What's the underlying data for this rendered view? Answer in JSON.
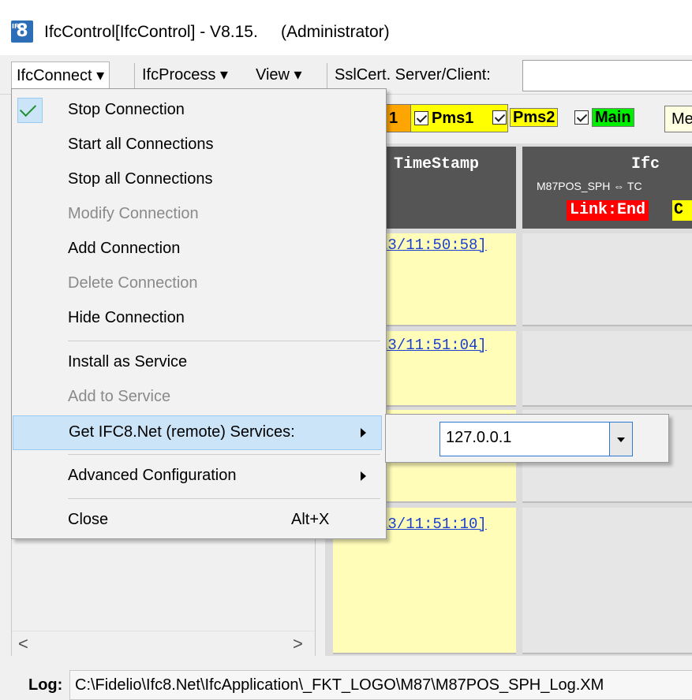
{
  "window": {
    "title": "IfcControl[IfcControl] - V8.15.     (Administrator)",
    "logo_text": "8",
    "logo_small": "IFC"
  },
  "menubar": {
    "items": [
      "IfcConnect ▾",
      "IfcProcess ▾",
      "View ▾",
      "SslCert. Server/Client:"
    ]
  },
  "toolbar": {
    "checks": [
      "1",
      "Pms1",
      "Pms2",
      "Main"
    ],
    "message_box": "Me"
  },
  "grid": {
    "header_timestamp": "TimeStamp",
    "header_ifc_title": "Ifc",
    "header_ifc_sub": "M87POS_SPH ⇔ TC",
    "link_end": "Link:End",
    "link_c": "C",
    "timestamps": [
      "13/11:50:58]",
      "13/11:51:04]",
      "13/11:51:10]"
    ]
  },
  "dropdown": {
    "items": [
      {
        "label": "Stop Connection",
        "checked": true,
        "enabled": true
      },
      {
        "label": "Start all Connections",
        "enabled": true
      },
      {
        "label": "Stop all Connections",
        "enabled": true
      },
      {
        "label": "Modify Connection",
        "enabled": false
      },
      {
        "label": "Add Connection",
        "enabled": true
      },
      {
        "label": "Delete Connection",
        "enabled": false
      },
      {
        "label": "Hide Connection",
        "enabled": true
      },
      {
        "label": "Install as Service",
        "enabled": true
      },
      {
        "label": "Add to Service",
        "enabled": false
      },
      {
        "label": "Get IFC8.Net (remote) Services:",
        "enabled": true,
        "submenu": true
      },
      {
        "label": "Advanced Configuration",
        "enabled": true,
        "submenu": true
      },
      {
        "label": "Close",
        "enabled": true,
        "shortcut": "Alt+X"
      }
    ]
  },
  "submenu": {
    "combo_value": "127.0.0.1"
  },
  "left_pane": {
    "scroll_left": "<",
    "scroll_right": ">"
  },
  "status": {
    "log_label": "Log:",
    "log_path": "C:\\Fidelio\\Ifc8.Net\\IfcApplication\\_FKT_LOGO\\M87\\M87POS_SPH_Log.XM"
  },
  "colors": {
    "highlight": "#cce4f7",
    "link_end": "#ff0000",
    "timestamp_bg": "#fffdb8",
    "header_bg": "#555555"
  }
}
